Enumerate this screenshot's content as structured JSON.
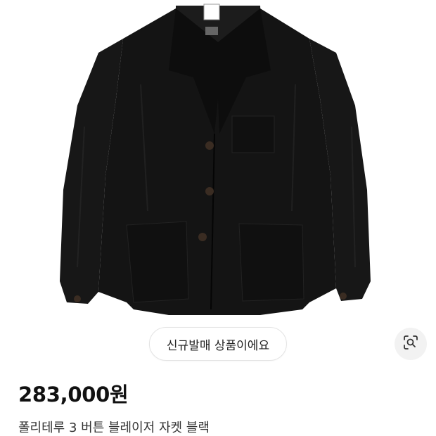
{
  "product": {
    "image_icon": "black-jacket-photo",
    "badge_label": "신규발매 상품이에요",
    "lens_icon": "image-search-icon",
    "price": "283,000원",
    "name": "폴리테루 3 버튼 블레이저 자켓 블랙"
  },
  "colors": {
    "jacket": "#141414",
    "badge_border": "#e3e3e3",
    "lens_bg": "#f2f2f2"
  }
}
